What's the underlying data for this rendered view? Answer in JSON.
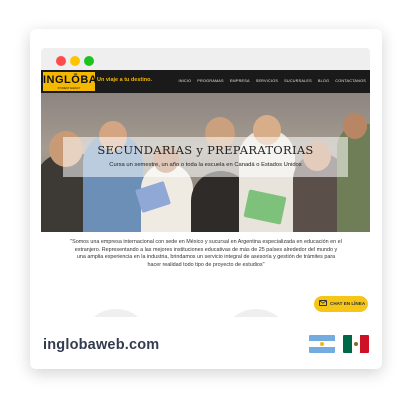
{
  "browser": {
    "dots": [
      {
        "name": "close-dot",
        "color": "#ff4b4b"
      },
      {
        "name": "minimize-dot",
        "color": "#ffc400"
      },
      {
        "name": "maximize-dot",
        "color": "#1ec21e"
      }
    ]
  },
  "navbar": {
    "logo_text": "INGLŌBA",
    "logo_sub": "STUDENT AGENCY",
    "tagline": "Un viaje a tu destino.",
    "menu": [
      "INICIO",
      "PROGRAMAS",
      "EMPRESA",
      "SERVICIOS",
      "SUCURSALES",
      "BLOG",
      "CONTACTANOS"
    ]
  },
  "hero": {
    "title": "SECUNDARIAS y PREPARATORIAS",
    "subtitle": "Cursa un semestre, un año o toda la escuela en Canadá o Estados Unidos"
  },
  "about": {
    "text": "\"Somos una empresa internacional con sede en México y sucursal en Argentina especializada en educación en el extranjero. Representando a las mejores instituciones educativas de más de 25 países alrededor del mundo y una amplia experiencia en la industria, brindamos un servicio integral de asesoría y gestión de trámites para hacer realidad todo tipo de proyecto de estudios\""
  },
  "chat": {
    "label": "CHAT EN LÍNEA",
    "icon": "envelope-icon"
  },
  "footer": {
    "url": "inglobaweb.com",
    "flags": [
      "argentina-flag",
      "mexico-flag"
    ]
  },
  "colors": {
    "brand_yellow": "#f5b800",
    "nav_dark": "#1a1a1a",
    "url_text": "#333b4e"
  }
}
